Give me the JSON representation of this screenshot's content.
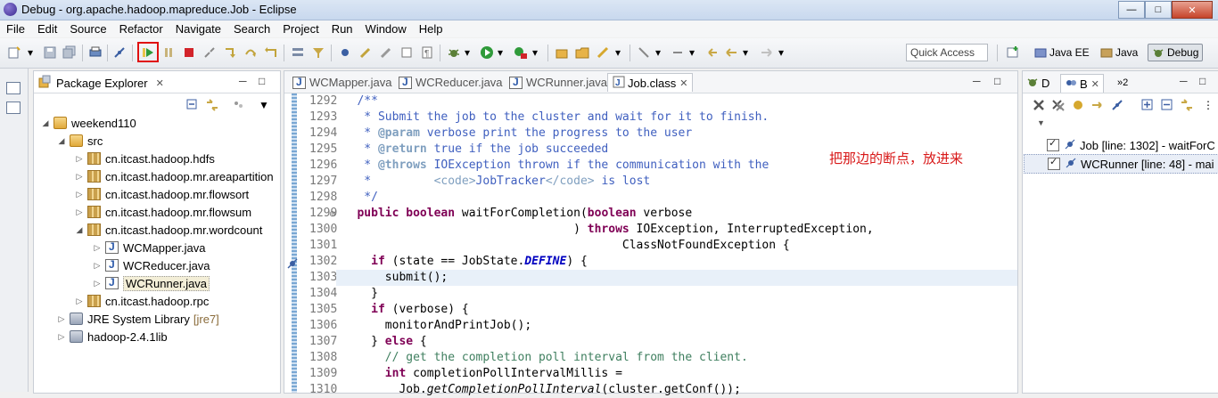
{
  "window": {
    "title": "Debug - org.apache.hadoop.mapreduce.Job - Eclipse"
  },
  "menu": [
    "File",
    "Edit",
    "Source",
    "Refactor",
    "Navigate",
    "Search",
    "Project",
    "Run",
    "Window",
    "Help"
  ],
  "toolbar": {
    "quick_access": "Quick Access"
  },
  "perspectives": [
    {
      "label": "Java EE"
    },
    {
      "label": "Java"
    },
    {
      "label": "Debug",
      "active": true
    }
  ],
  "package_explorer": {
    "title": "Package Explorer",
    "tree": [
      {
        "label": "weekend110",
        "kind": "project"
      },
      {
        "label": "src",
        "kind": "src"
      },
      {
        "label": "cn.itcast.hadoop.hdfs",
        "kind": "package"
      },
      {
        "label": "cn.itcast.hadoop.mr.areapartition",
        "kind": "package"
      },
      {
        "label": "cn.itcast.hadoop.mr.flowsort",
        "kind": "package"
      },
      {
        "label": "cn.itcast.hadoop.mr.flowsum",
        "kind": "package"
      },
      {
        "label": "cn.itcast.hadoop.mr.wordcount",
        "kind": "package"
      },
      {
        "label": "WCMapper.java",
        "kind": "java"
      },
      {
        "label": "WCReducer.java",
        "kind": "java"
      },
      {
        "label": "WCRunner.java",
        "kind": "java"
      },
      {
        "label": "cn.itcast.hadoop.rpc",
        "kind": "package"
      },
      {
        "label": "JRE System Library",
        "extra": "[jre7]",
        "kind": "lib"
      },
      {
        "label": "hadoop-2.4.1lib",
        "kind": "lib"
      }
    ]
  },
  "editor": {
    "tabs": [
      {
        "label": "WCMapper.java"
      },
      {
        "label": "WCReducer.java"
      },
      {
        "label": "WCRunner.java"
      },
      {
        "label": "Job.class",
        "active": true
      }
    ],
    "line_numbers": [
      "1292",
      "1293",
      "1294",
      "1295",
      "1296",
      "1297",
      "1298",
      "1299",
      "1300",
      "1301",
      "1302",
      "1303",
      "1304",
      "1305",
      "1306",
      "1307",
      "1308",
      "1309",
      "1310"
    ]
  },
  "annotation_note": "把那边的断点，放进来",
  "right_panel": {
    "tabs": [
      {
        "label": "D"
      },
      {
        "label": "B"
      },
      {
        "label": "»2"
      }
    ],
    "breakpoints": [
      {
        "label": "Job [line: 1302] - waitForC"
      },
      {
        "label": "WCRunner [line: 48] - mai"
      }
    ]
  }
}
